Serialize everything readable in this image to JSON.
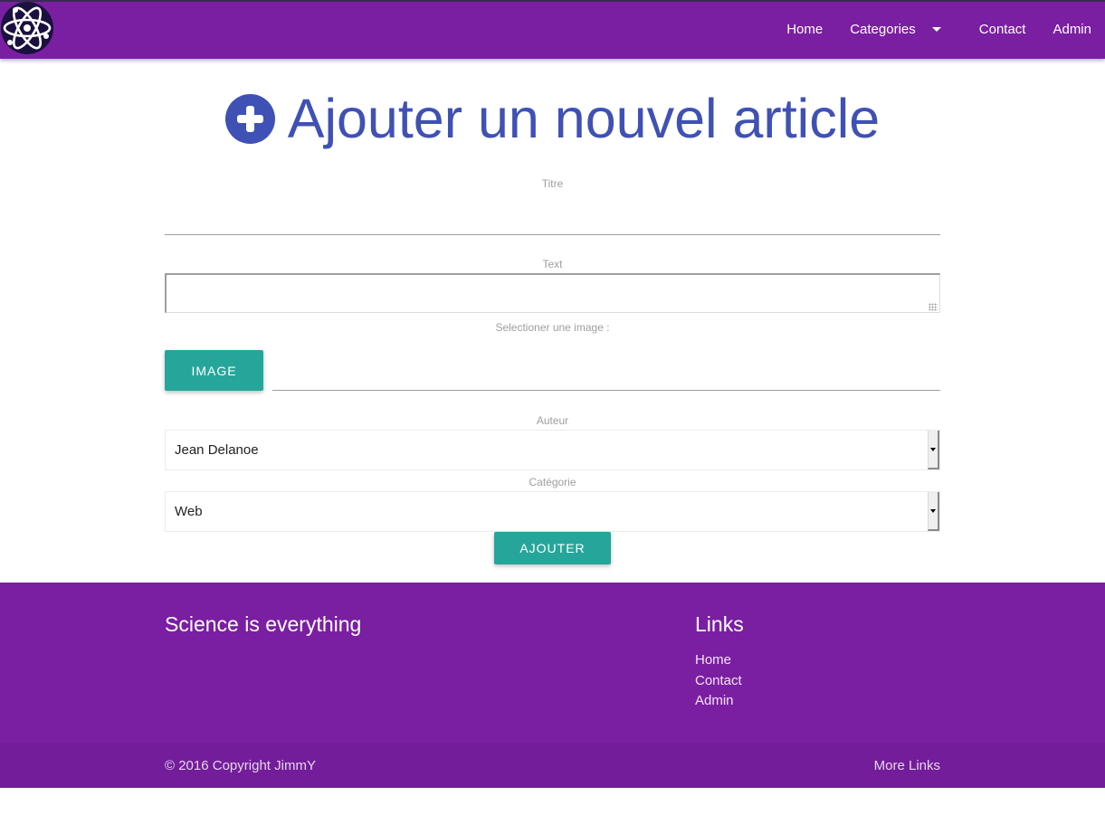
{
  "colors": {
    "navbar": "#7b1fa2",
    "title": "#3f51b5",
    "button": "#26a69a",
    "footer": "#7b1fa2"
  },
  "nav": {
    "logo_icon": "atom-icon",
    "links": [
      "Home",
      "Categories",
      "Contact",
      "Admin"
    ]
  },
  "page": {
    "title": "Ajouter un nouvel article",
    "title_icon": "plus-circle-icon"
  },
  "form": {
    "titre_label": "Titre",
    "titre_value": "",
    "text_label": "Text",
    "text_value": "",
    "image_label": "Selectioner une image :",
    "image_button": "Image",
    "file_path_value": "",
    "auteur_label": "Auteur",
    "auteur_selected": "Jean Delanoe",
    "categorie_label": "Catégorie",
    "categorie_selected": "Web",
    "submit_button": "Ajouter"
  },
  "footer": {
    "title": "Science is everything",
    "links_title": "Links",
    "links": [
      "Home",
      "Contact",
      "Admin"
    ],
    "copyright": "© 2016 Copyright JimmY",
    "more_links": "More Links"
  }
}
